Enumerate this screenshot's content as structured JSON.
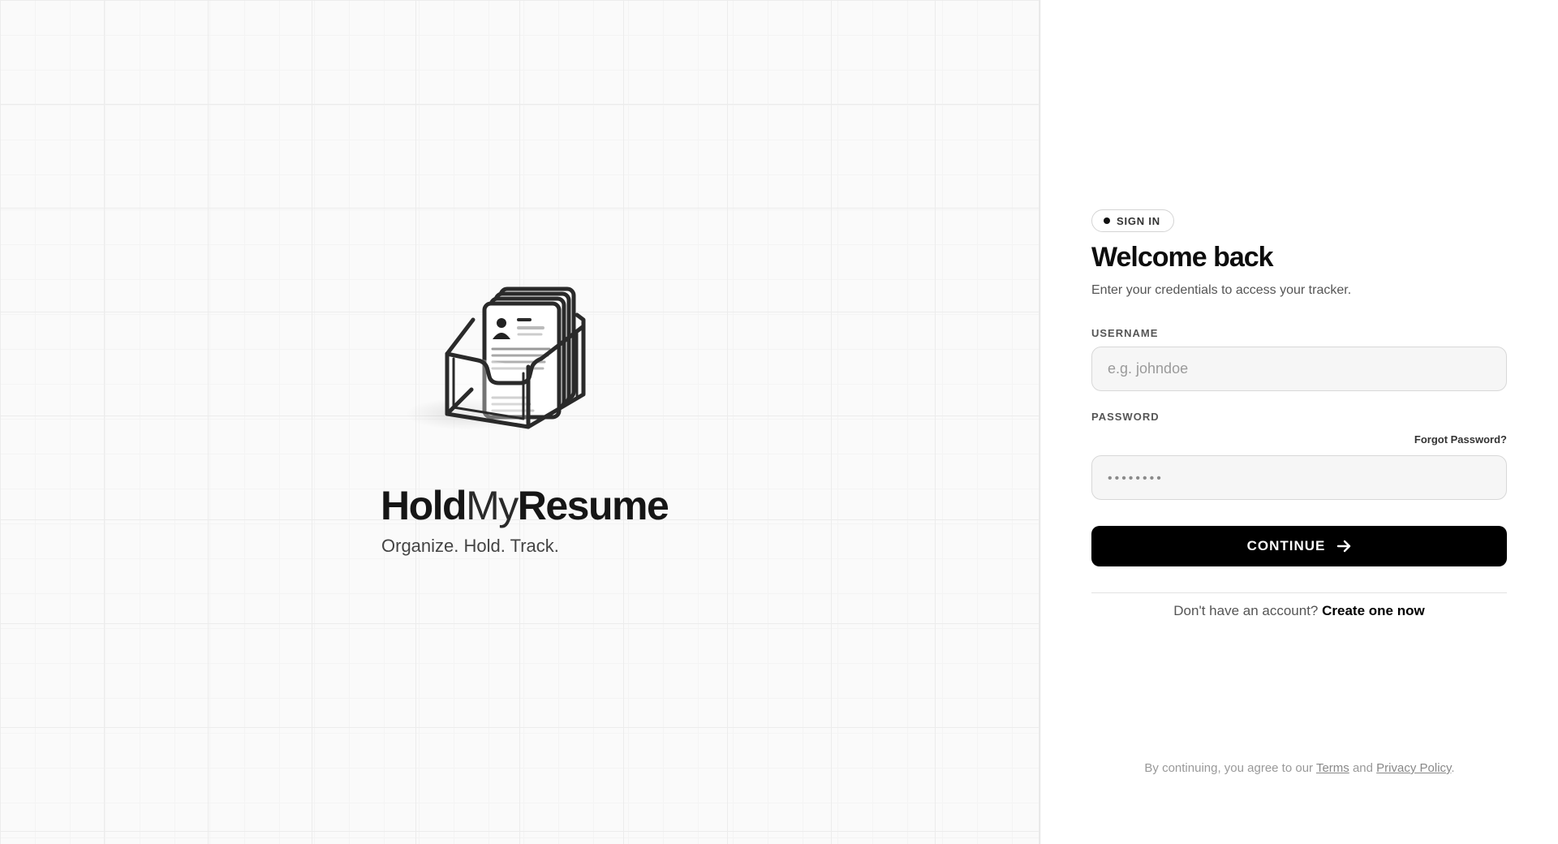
{
  "brand": {
    "name_part1": "Hold",
    "name_part2": "My",
    "name_part3": "Resume",
    "tagline": "Organize. Hold. Track.",
    "logo_icon": "resume-holder-icon"
  },
  "auth": {
    "badge": "SIGN IN",
    "title": "Welcome back",
    "subtitle": "Enter your credentials to access your tracker.",
    "username": {
      "label": "USERNAME",
      "placeholder": "e.g. johndoe",
      "value": ""
    },
    "password": {
      "label": "PASSWORD",
      "placeholder": "••••••••",
      "value": "",
      "forgot_label": "Forgot Password?"
    },
    "continue_label": "CONTINUE",
    "continue_icon": "arrow-right-icon",
    "signup_prompt": "Don't have an account?",
    "signup_link": "Create one now"
  },
  "legal": {
    "prefix": "By continuing, you agree to our",
    "terms": "Terms",
    "and": "and",
    "privacy": "Privacy Policy",
    "suffix": "."
  },
  "colors": {
    "primary": "#000000",
    "background_left": "#fafafa",
    "background_right": "#ffffff",
    "muted_text": "#555555"
  }
}
